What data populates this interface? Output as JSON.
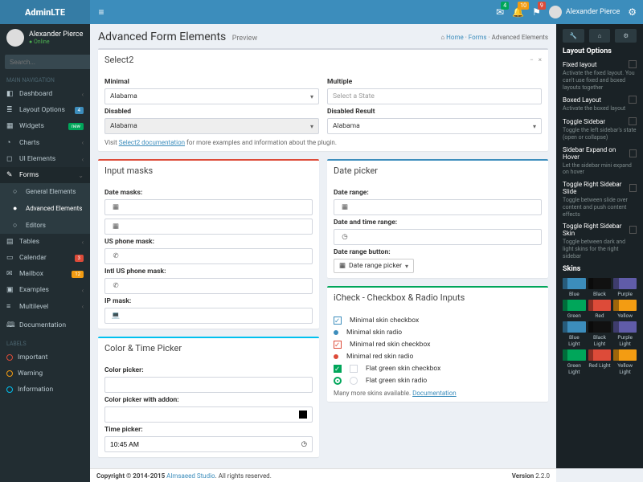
{
  "brand": {
    "a": "Admin",
    "b": "LTE"
  },
  "topbar": {
    "notifications": [
      {
        "badge": "4",
        "cls": "badge-green"
      },
      {
        "badge": "10",
        "cls": "badge-yellow"
      },
      {
        "badge": "9",
        "cls": "badge-red"
      }
    ],
    "user": "Alexander Pierce"
  },
  "user_panel": {
    "name": "Alexander Pierce",
    "status": "Online"
  },
  "search": {
    "placeholder": "Search..."
  },
  "nav_header": "MAIN NAVIGATION",
  "nav": [
    {
      "icon": "◧",
      "label": "Dashboard",
      "arrow": true
    },
    {
      "icon": "≣",
      "label": "Layout Options",
      "pill": "4",
      "pill_bg": "#3c8dbc"
    },
    {
      "icon": "▦",
      "label": "Widgets",
      "pill": "new",
      "pill_bg": "#00a65a"
    },
    {
      "icon": "◔",
      "label": "Charts",
      "arrow": true
    },
    {
      "icon": "◻",
      "label": "UI Elements",
      "arrow": true
    }
  ],
  "forms": {
    "label": "Forms",
    "items": [
      {
        "label": "General Elements",
        "icon": "○"
      },
      {
        "label": "Advanced Elements",
        "icon": "●",
        "sel": true
      },
      {
        "label": "Editors",
        "icon": "○"
      }
    ]
  },
  "nav2": [
    {
      "icon": "▤",
      "label": "Tables",
      "arrow": true
    },
    {
      "icon": "▭",
      "label": "Calendar",
      "pill": "3",
      "pill_bg": "#dd4b39"
    },
    {
      "icon": "✉",
      "label": "Mailbox",
      "pill": "12",
      "pill_bg": "#f39c12"
    },
    {
      "icon": "▣",
      "label": "Examples",
      "arrow": true
    },
    {
      "icon": "≡",
      "label": "Multilevel",
      "arrow": true
    },
    {
      "icon": "🕮",
      "label": "Documentation"
    }
  ],
  "labels_header": "LABELS",
  "label_items": [
    {
      "label": "Important",
      "color": "#dd4b39"
    },
    {
      "label": "Warning",
      "color": "#f39c12"
    },
    {
      "label": "Information",
      "color": "#00c0ef"
    }
  ],
  "page": {
    "title": "Advanced Form Elements",
    "subtitle": "Preview"
  },
  "breadcrumb": {
    "home": "Home",
    "mid": "Forms",
    "cur": "Advanced Elements"
  },
  "select2": {
    "title": "Select2",
    "minimal_lbl": "Minimal",
    "minimal_val": "Alabama",
    "disabled_lbl": "Disabled",
    "disabled_val": "Alabama",
    "multiple_lbl": "Multiple",
    "multiple_ph": "Select a State",
    "disres_lbl": "Disabled Result",
    "disres_val": "Alabama",
    "note_pre": "Visit ",
    "note_link": "Select2 documentation",
    "note_post": " for more examples and information about the plugin."
  },
  "masks": {
    "title": "Input masks",
    "date_lbl": "Date masks:",
    "us_lbl": "US phone mask:",
    "intl_lbl": "Intl US phone mask:",
    "ip_lbl": "IP mask:"
  },
  "datepicker": {
    "title": "Date picker",
    "range_lbl": "Date range:",
    "time_lbl": "Date and time range:",
    "btn_lbl": "Date range button:",
    "btn_text": "Date range picker"
  },
  "colorpicker": {
    "title": "Color & Time Picker",
    "cp_lbl": "Color picker:",
    "cpa_lbl": "Color picker with addon:",
    "tp_lbl": "Time picker:",
    "tp_val": "10:45 AM"
  },
  "icheck": {
    "title": "iCheck - Checkbox & Radio Inputs",
    "rows": [
      "Minimal skin checkbox",
      "Minimal skin radio",
      "Minimal red skin checkbox",
      "Minimal red skin radio",
      "Flat green skin checkbox",
      "Flat green skin radio"
    ],
    "note_pre": "Many more skins available. ",
    "note_link": "Documentation"
  },
  "settings": {
    "title": "Layout Options",
    "opts": [
      {
        "t": "Fixed layout",
        "d": "Activate the fixed layout. You can't use fixed and boxed layouts together"
      },
      {
        "t": "Boxed Layout",
        "d": "Activate the boxed layout"
      },
      {
        "t": "Toggle Sidebar",
        "d": "Toggle the left sidebar's state (open or collapse)"
      },
      {
        "t": "Sidebar Expand on Hover",
        "d": "Let the sidebar mini expand on hover"
      },
      {
        "t": "Toggle Right Sidebar Slide",
        "d": "Toggle between slide over content and push content effects"
      },
      {
        "t": "Toggle Right Sidebar Skin",
        "d": "Toggle between dark and light skins for the right sidebar"
      }
    ],
    "skins_title": "Skins",
    "skins": [
      {
        "name": "Blue",
        "c": "#3c8dbc"
      },
      {
        "name": "Black",
        "c": "#111"
      },
      {
        "name": "Purple",
        "c": "#605ca8"
      },
      {
        "name": "Green",
        "c": "#00a65a"
      },
      {
        "name": "Red",
        "c": "#dd4b39"
      },
      {
        "name": "Yellow",
        "c": "#f39c12"
      },
      {
        "name": "Blue Light",
        "c": "#3c8dbc"
      },
      {
        "name": "Black Light",
        "c": "#111"
      },
      {
        "name": "Purple Light",
        "c": "#605ca8"
      },
      {
        "name": "Green Light",
        "c": "#00a65a"
      },
      {
        "name": "Red Light",
        "c": "#dd4b39"
      },
      {
        "name": "Yellow Light",
        "c": "#f39c12"
      }
    ]
  },
  "footer": {
    "copy": "Copyright © 2014-2015 ",
    "brand": "Almsaeed Studio",
    "rights": ". All rights reserved.",
    "ver_lbl": "Version ",
    "ver": "2.2.0"
  }
}
